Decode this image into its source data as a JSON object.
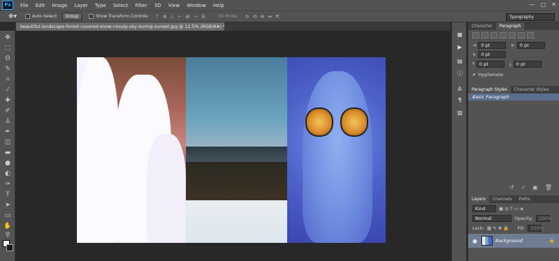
{
  "app": {
    "logo": "Ps"
  },
  "menu": [
    "File",
    "Edit",
    "Image",
    "Layer",
    "Type",
    "Select",
    "Filter",
    "3D",
    "View",
    "Window",
    "Help"
  ],
  "window_controls": {
    "minimize": "—",
    "restore": "▢",
    "close": "✕"
  },
  "options": {
    "auto_select_label": "Auto-Select:",
    "auto_select_value": "Group",
    "transform_label": "Show Transform Controls",
    "mode_3d_label": "3D Mode:",
    "workspace": "Typography"
  },
  "document": {
    "tab_title": "beautiful-landscape-forest-covered-snow-cloudy-sky-during-sunset.jpg @ 12.5% (RGB/8#) *"
  },
  "character_panel": {
    "tabs": [
      "Character",
      "Paragraph"
    ],
    "active_tab": "Paragraph",
    "fields": [
      "0 pt",
      "0 pt",
      "0 pt",
      "0 pt",
      "0 pt"
    ],
    "hyphenate_label": "Hyphenate"
  },
  "styles_panel": {
    "tabs": [
      "Paragraph Styles",
      "Character Styles"
    ],
    "items": [
      "Basic Paragraph"
    ]
  },
  "layers_panel": {
    "tabs": [
      "Layers",
      "Channels",
      "Paths"
    ],
    "kind_label": "Kind",
    "blend_mode": "Normal",
    "opacity_label": "Opacity:",
    "opacity_value": "100%",
    "lock_label": "Lock:",
    "fill_label": "Fill:",
    "fill_value": "100%",
    "layers": [
      {
        "name": "Background",
        "visible": true,
        "locked": true
      }
    ]
  },
  "colors": {
    "accent": "#31a8ff",
    "foreground": "#ffffff",
    "background": "#1b1b1b"
  }
}
